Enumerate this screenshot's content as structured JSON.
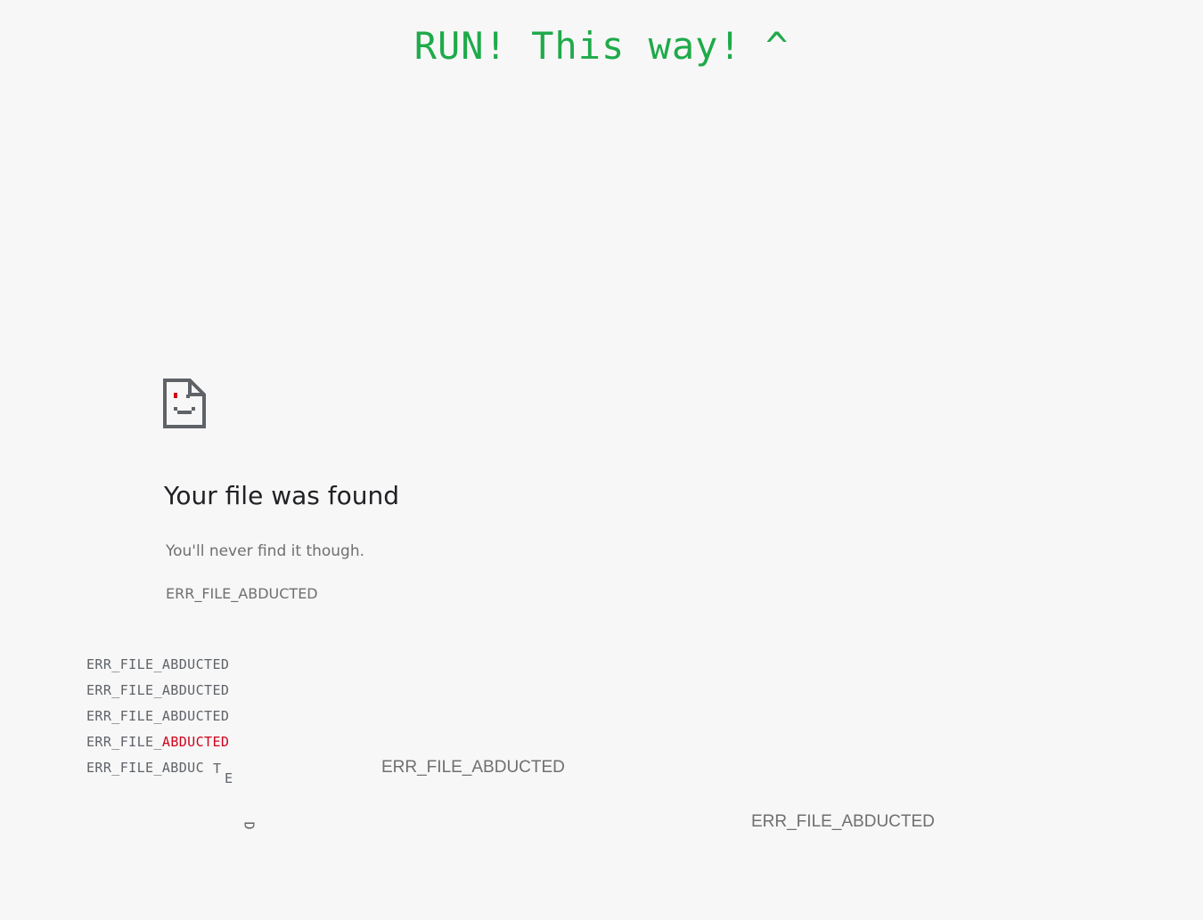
{
  "banner": {
    "text": "RUN! This way! ^"
  },
  "error_page": {
    "icon": "broken-file-smiley-icon",
    "title": "Your file was found",
    "subtitle": "You'll never find it though.",
    "code": "ERR_FILE_ABDUCTED"
  },
  "abducted_list": {
    "lines": [
      "ERR_FILE_ABDUCTED",
      "ERR_FILE_ABDUCTED",
      "ERR_FILE_ABDUCTED"
    ],
    "highlight_line": {
      "prefix": "ERR_FILE_",
      "highlight": "ABDUCTED"
    },
    "falling_line": {
      "prefix": "ERR_FILE_ABDUC",
      "letters": [
        "T",
        "E",
        "D"
      ]
    }
  },
  "floating_codes": [
    "ERR_FILE_ABDUCTED",
    "ERR_FILE_ABDUCTED"
  ],
  "colors": {
    "banner": "#1faa4a",
    "highlight": "#d0021b",
    "background": "#f7f7f7"
  }
}
